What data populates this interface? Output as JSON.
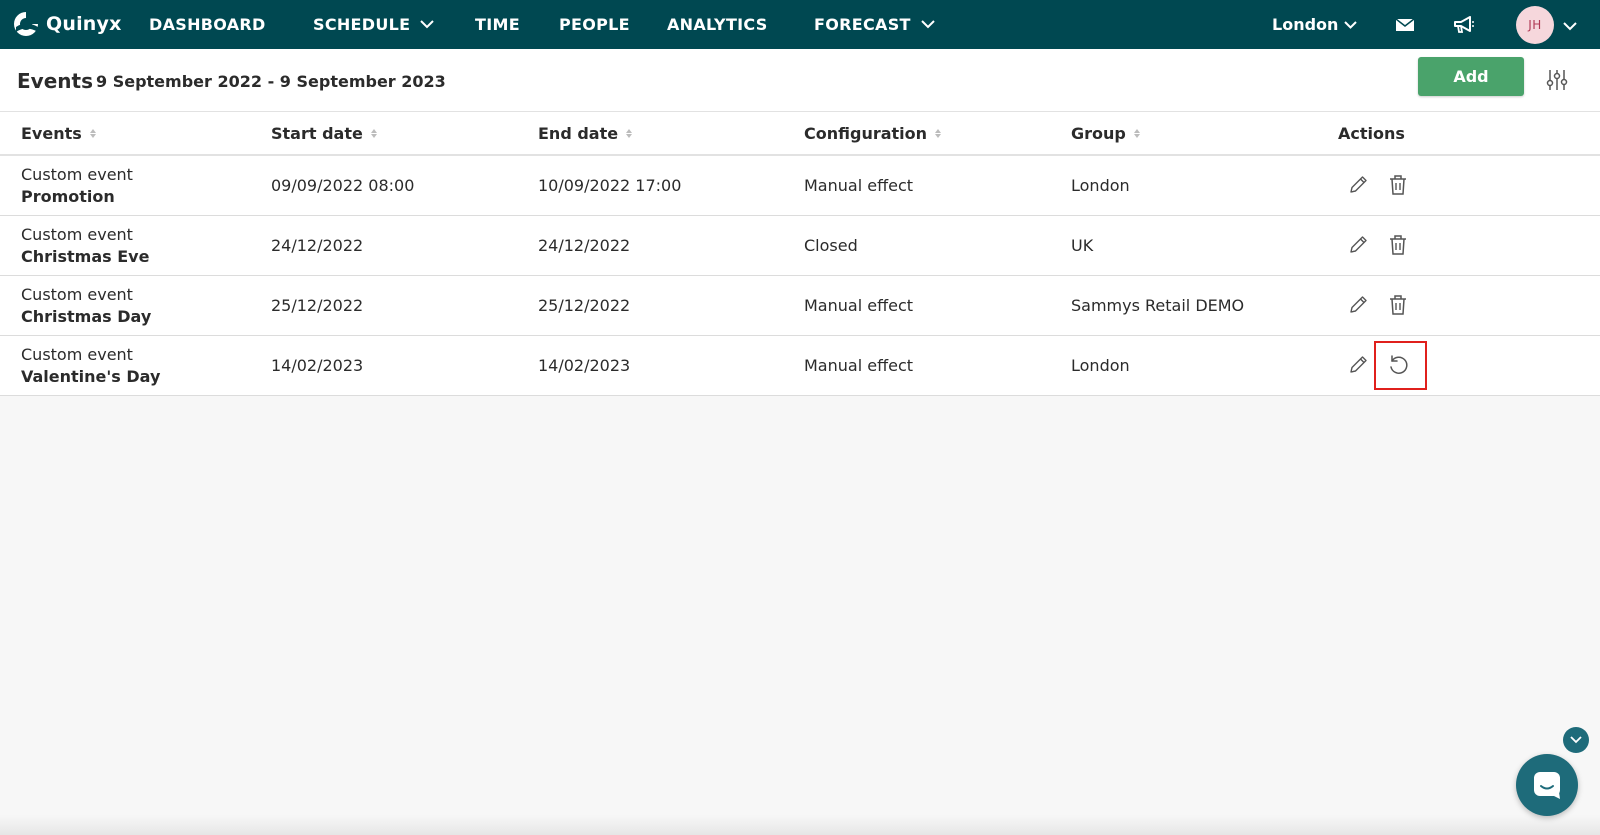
{
  "nav": {
    "brand": "Quinyx",
    "items": [
      {
        "label": "DASHBOARD",
        "has_dropdown": false
      },
      {
        "label": "SCHEDULE",
        "has_dropdown": true
      },
      {
        "label": "TIME",
        "has_dropdown": false
      },
      {
        "label": "PEOPLE",
        "has_dropdown": false
      },
      {
        "label": "ANALYTICS",
        "has_dropdown": false
      },
      {
        "label": "FORECAST",
        "has_dropdown": true
      }
    ],
    "location": "London",
    "user_initials": "JH",
    "icons": [
      "mail-icon",
      "megaphone-icon"
    ]
  },
  "header": {
    "title": "Events",
    "date_range": "9 September 2022 - 9 September 2023",
    "add_label": "Add"
  },
  "table": {
    "columns": [
      {
        "label": "Events",
        "sortable": true
      },
      {
        "label": "Start date",
        "sortable": true
      },
      {
        "label": "End date",
        "sortable": true
      },
      {
        "label": "Configuration",
        "sortable": true
      },
      {
        "label": "Group",
        "sortable": true
      },
      {
        "label": "Actions",
        "sortable": false
      }
    ],
    "rows": [
      {
        "type": "Custom event",
        "name": "Promotion",
        "start": "09/09/2022 08:00",
        "end": "10/09/2022 17:00",
        "config": "Manual effect",
        "group": "London",
        "second_action": "delete"
      },
      {
        "type": "Custom event",
        "name": "Christmas Eve",
        "start": "24/12/2022",
        "end": "24/12/2022",
        "config": "Closed",
        "group": "UK",
        "second_action": "delete"
      },
      {
        "type": "Custom event",
        "name": "Christmas Day",
        "start": "25/12/2022",
        "end": "25/12/2022",
        "config": "Manual effect",
        "group": "Sammys Retail DEMO",
        "second_action": "delete"
      },
      {
        "type": "Custom event",
        "name": "Valentine's Day",
        "start": "14/02/2023",
        "end": "14/02/2023",
        "config": "Manual effect",
        "group": "London",
        "second_action": "revert"
      }
    ]
  },
  "colors": {
    "topbar": "#004851",
    "add_button": "#4aa36b",
    "highlight": "#e0201c",
    "chat": "#1e6b7a"
  }
}
